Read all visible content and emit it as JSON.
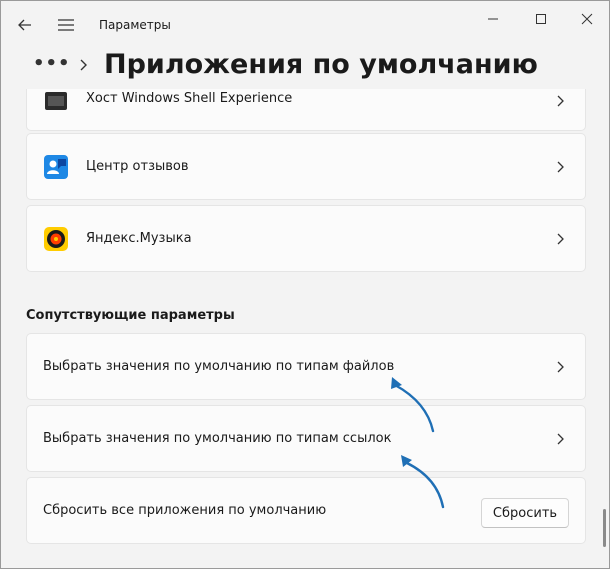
{
  "window": {
    "title": "Параметры"
  },
  "header": {
    "breadcrumb_dots": "•••",
    "page_title": "Приложения по умолчанию"
  },
  "apps": [
    {
      "label": "Хост Windows Shell Experience",
      "icon": "shell-experience-icon"
    },
    {
      "label": "Центр отзывов",
      "icon": "feedback-hub-icon"
    },
    {
      "label": "Яндекс.Музыка",
      "icon": "yandex-music-icon"
    }
  ],
  "related": {
    "title": "Сопутствующие параметры",
    "items": [
      {
        "label": "Выбрать значения по умолчанию по типам файлов"
      },
      {
        "label": "Выбрать значения по умолчанию по типам ссылок"
      }
    ],
    "reset": {
      "label": "Сбросить все приложения по умолчанию",
      "button": "Сбросить"
    }
  },
  "colors": {
    "annotation_arrow": "#1f6fb5",
    "feedback_icon": "#1e88e5",
    "yandex_music_icon": "#ffcc00"
  }
}
